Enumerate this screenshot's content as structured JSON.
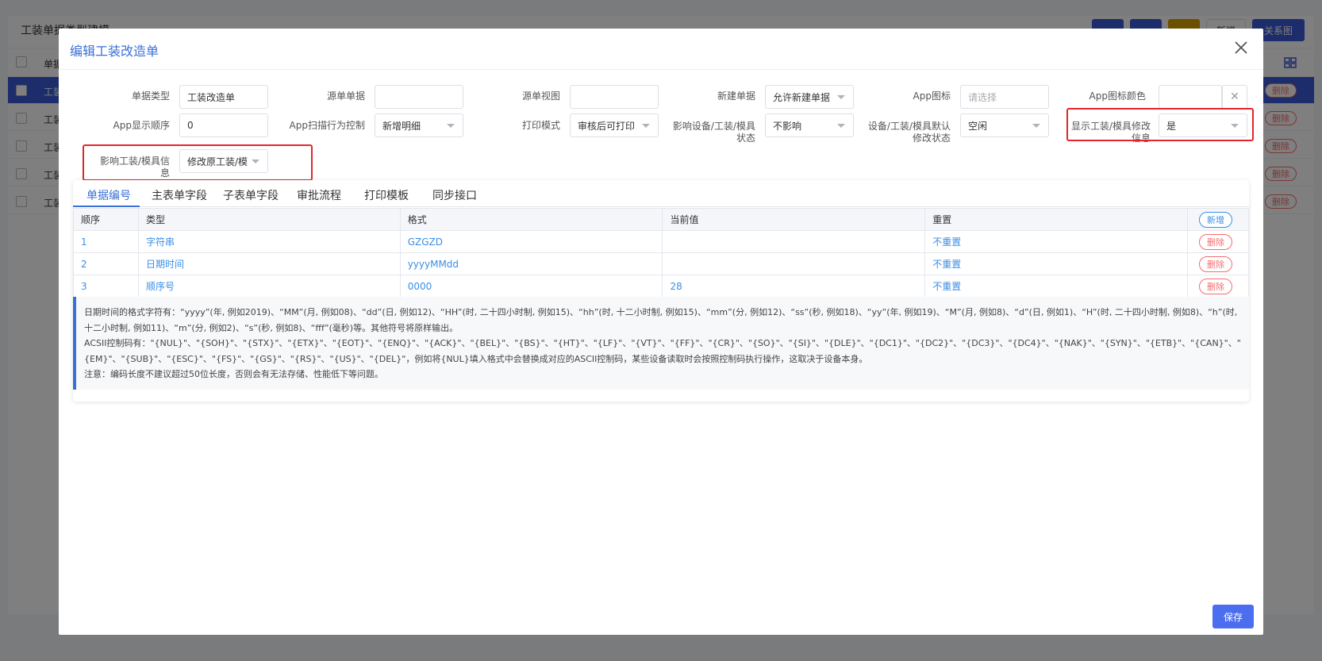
{
  "background": {
    "title": "工装单据类型建模",
    "buttons": {
      "new": "新增",
      "relation": "关系图"
    },
    "rows": [
      {
        "label": "工装"
      },
      {
        "label": "工装"
      },
      {
        "label": "工装"
      },
      {
        "label": "工装"
      },
      {
        "label": "工装"
      }
    ],
    "header_col": "单据",
    "delete_label": "删除"
  },
  "modal": {
    "title": "编辑工装改造单",
    "form": {
      "doc_type": {
        "label": "单据类型",
        "value": "工装改造单"
      },
      "source_doc": {
        "label": "源单单据",
        "value": ""
      },
      "source_view": {
        "label": "源单视图",
        "value": ""
      },
      "new_doc": {
        "label": "新建单据",
        "value": "允许新建单据"
      },
      "app_icon": {
        "label": "App图标",
        "placeholder": "请选择"
      },
      "app_icon_color": {
        "label": "App图标颜色",
        "value": ""
      },
      "app_order": {
        "label": "App显示顺序",
        "value": "0"
      },
      "app_scan": {
        "label": "App扫描行为控制",
        "value": "新增明细"
      },
      "print_mode": {
        "label": "打印模式",
        "value": "审核后可打印"
      },
      "affect_equip_state": {
        "label": "影响设备/工装/模具状态",
        "value": "不影响"
      },
      "default_state": {
        "label": "设备/工装/模具默认修改状态",
        "value": "空闲"
      },
      "show_modify": {
        "label": "显示工装/模具修改信息",
        "value": "是"
      },
      "affect_info": {
        "label": "影响工装/模具信息",
        "value": "修改原工装/模具"
      }
    },
    "tabs": [
      "单据编号",
      "主表单字段",
      "子表单字段",
      "审批流程",
      "打印模板",
      "同步接口"
    ],
    "table": {
      "headers": [
        "顺序",
        "类型",
        "格式",
        "当前值",
        "重置"
      ],
      "add_label": "新增",
      "delete_label": "删除",
      "rows": [
        {
          "order": "1",
          "type": "字符串",
          "format": "GZGZD",
          "current": "",
          "reset": "不重置"
        },
        {
          "order": "2",
          "type": "日期时间",
          "format": "yyyyMMdd",
          "current": "",
          "reset": "不重置"
        },
        {
          "order": "3",
          "type": "顺序号",
          "format": "0000",
          "current": "28",
          "reset": "不重置"
        }
      ]
    },
    "notes": {
      "line1": "日期时间的格式字符有：“yyyy”(年, 例如2019)、“MM”(月, 例如08)、“dd”(日, 例如12)、“HH”(时, 二十四小时制, 例如15)、“hh”(时, 十二小时制, 例如15)、“mm”(分, 例如12)、“ss”(秒, 例如18)、“yy”(年, 例如19)、“M”(月, 例如8)、“d”(日, 例如1)、“H”(时, 二十四小时制, 例如8)、“h”(时, 十二小时制, 例如11)、“m”(分, 例如2)、“s”(秒, 例如8)、“fff”(毫秒)等。其他符号将原样输出。",
      "line2": "ACSII控制码有：\"{NUL}\"、\"{SOH}\"、\"{STX}\"、\"{ETX}\"、\"{EOT}\"、\"{ENQ}\"、\"{ACK}\"、\"{BEL}\"、\"{BS}\"、\"{HT}\"、\"{LF}\"、\"{VT}\"、\"{FF}\"、\"{CR}\"、\"{SO}\"、\"{SI}\"、\"{DLE}\"、\"{DC1}\"、\"{DC2}\"、\"{DC3}\"、\"{DC4}\"、\"{NAK}\"、\"{SYN}\"、\"{ETB}\"、\"{CAN}\"、\"{EM}\"、\"{SUB}\"、\"{ESC}\"、\"{FS}\"、\"{GS}\"、\"{RS}\"、\"{US}\"、\"{DEL}\"，例如将{NUL}填入格式中会替换成对应的ASCII控制码，某些设备读取时会按照控制码执行操作，这取决于设备本身。",
      "line3": "注意：编码长度不建议超过50位长度，否则会有无法存储、性能低下等问题。"
    },
    "save_label": "保存"
  },
  "colors": {
    "accent": "#3a6fd8",
    "danger": "#f56c6c",
    "highlight": "#e4262a"
  }
}
